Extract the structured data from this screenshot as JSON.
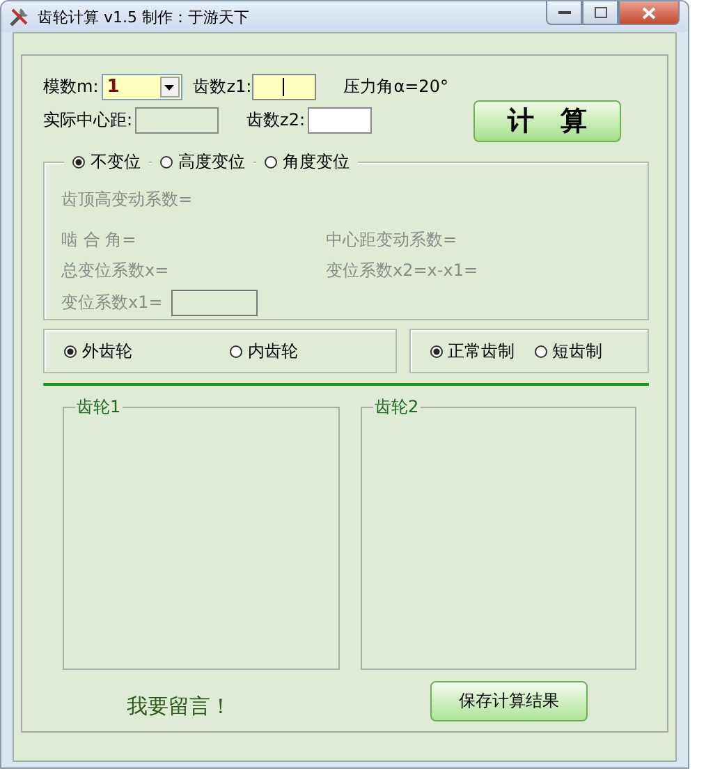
{
  "window": {
    "title": "齿轮计算 v1.5  制作：于游天下"
  },
  "module": {
    "label": "模数m:",
    "value": "1"
  },
  "z1": {
    "label": "齿数z1:",
    "focused": true
  },
  "pressure_angle": "压力角α=20°",
  "center_distance": {
    "label": "实际中心距:"
  },
  "z2": {
    "label": "齿数z2:"
  },
  "calculate_button": "计　算",
  "shift_modes": [
    {
      "label": "不变位",
      "selected": true
    },
    {
      "label": "高度变位",
      "selected": false
    },
    {
      "label": "角度变位",
      "selected": false
    }
  ],
  "results": {
    "disabled": true,
    "addendum": "齿顶高变动系数=",
    "mesh_angle": "啮 合 角=",
    "center_coeff": "中心距变动系数=",
    "total_shift": "总变位系数x=",
    "shift_x2": "变位系数x2=x-x1=",
    "shift_x1": "变位系数x1="
  },
  "gear_types": [
    {
      "label": "外齿轮",
      "selected": true
    },
    {
      "label": "内齿轮",
      "selected": false
    }
  ],
  "tooth_systems": [
    {
      "label": "正常齿制",
      "selected": true
    },
    {
      "label": "短齿制",
      "selected": false
    }
  ],
  "gear_panels": [
    "齿轮1",
    "齿轮2"
  ],
  "message_link": "我要留言！",
  "save_button": "保存计算结果"
}
